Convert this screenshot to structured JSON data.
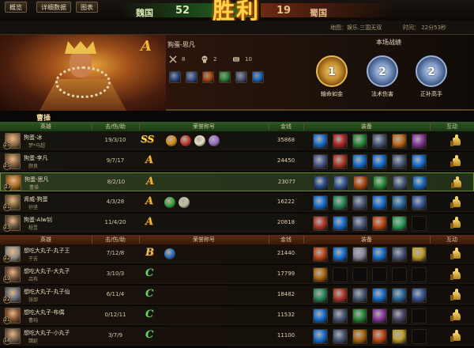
{
  "scoreboard": {
    "team_left": "魏国",
    "score_left": "52",
    "victory_text": "胜利",
    "score_right": "19",
    "team_right": "蜀国"
  },
  "tabs": [
    "概览",
    "详细数据",
    "图表"
  ],
  "match_info": {
    "map": "地图：娱乐.三国无双",
    "time": "时间： 22分53秒"
  },
  "banner": {
    "grade": "A",
    "player": "狗蛋-思凡",
    "kills": "8",
    "deaths": "2",
    "assists": "10",
    "performance_title": "本场战绩",
    "medals": [
      {
        "rank": "1",
        "label": "输命如金",
        "color": "#e7b950"
      },
      {
        "rank": "2",
        "label": "法术伤害",
        "color": "#9ab2d8"
      },
      {
        "rank": "2",
        "label": "正补高手",
        "color": "#9ab2d8"
      }
    ],
    "team_label": "曹操",
    "items": [
      {
        "icon": "skill-icon",
        "color": "#2a4a8a"
      },
      {
        "icon": "sword-icon",
        "color": "#3a5a9a"
      },
      {
        "icon": "flame-icon",
        "color": "#b04a14"
      },
      {
        "icon": "jade-icon",
        "color": "#2a8a3a"
      },
      {
        "icon": "blade-icon",
        "color": "#4a5a7a"
      },
      {
        "icon": "crystal-icon",
        "color": "#1a6ac0"
      }
    ]
  },
  "table_headers": {
    "hero": "英雄",
    "kda": "击/伤/助",
    "honor": "荣誉称号",
    "gold": "金钱",
    "equip": "装备",
    "interact": "互动"
  },
  "team_wei": [
    {
      "player": "狗蛋-冰",
      "hero": "梦*马超",
      "level": "25",
      "kda": "19/3/10",
      "grade": "SS",
      "gold": "35868",
      "avatar": "#8a6a4a",
      "honors": [
        "#d88a1a",
        "#c03a2a",
        "#e8e0c0",
        "#9a6ac8"
      ],
      "equip": [
        "#1a70d0",
        "#b02a2a",
        "#2a8a3a",
        "#4a5a7a",
        "#c06a1a",
        "#8a3aa0"
      ]
    },
    {
      "player": "狗蛋-李凡",
      "hero": "颜良",
      "level": "25",
      "kda": "9/7/17",
      "grade": "A",
      "gold": "24450",
      "avatar": "#7a5a3a",
      "honors": [],
      "equip": [
        "#4a5a8a",
        "#b03a2a",
        "#1a70d0",
        "#1a70d0",
        "#4a5a7a",
        "#1a70d0"
      ]
    },
    {
      "player": "狗蛋-思凡",
      "hero": "曹操",
      "level": "23",
      "kda": "8/2/10",
      "grade": "A",
      "gold": "23077",
      "avatar": "#a0641e",
      "self": true,
      "honors": [],
      "equip": [
        "#2a4a8a",
        "#3a5a9a",
        "#b04a14",
        "#2a8a3a",
        "#4a5a7a",
        "#1a6ac0"
      ]
    },
    {
      "player": "肾威-狗蛋",
      "hero": "孙坚",
      "level": "21",
      "kda": "4/3/28",
      "grade": "A",
      "gold": "16222",
      "avatar": "#6a5a3a",
      "honors": [
        "#3aa03a",
        "#c0c0a0"
      ],
      "equip": [
        "#1a70d0",
        "#2a8a5a",
        "#4a5a7a",
        "#1a70d0",
        "#2a6aa0",
        "#3a5a9a"
      ]
    },
    {
      "player": "狗蛋-Alw钊",
      "hero": "程昱",
      "level": "23",
      "kda": "11/4/20",
      "grade": "A",
      "gold": "20818",
      "avatar": "#5a4a3a",
      "honors": [],
      "equip": [
        "#b03a2a",
        "#1a70d0",
        "#4a5a7a",
        "#c04a1a",
        "#2aa05a",
        ""
      ]
    }
  ],
  "team_shu": [
    {
      "player": "想吃大丸子-丸子王",
      "hero": "于吉",
      "level": "22",
      "kda": "7/12/8",
      "grade": "B",
      "gold": "21440",
      "avatar": "#8a8a8a",
      "honors": [
        "#2a6ab0"
      ],
      "equip": [
        "#c04a1a",
        "#1a70d0",
        "#8a8aa0",
        "#1a70d0",
        "#4a5a7a",
        "#c0a02a"
      ]
    },
    {
      "player": "想吃大丸子-大丸子",
      "hero": "吕布",
      "level": "19",
      "kda": "3/10/3",
      "grade": "C",
      "gold": "17799",
      "avatar": "#6a4a3a",
      "honors": [],
      "equip": [
        "#b06a14",
        "",
        "",
        "",
        "",
        ""
      ]
    },
    {
      "player": "想吃大丸子-丸子仙",
      "hero": "张郃",
      "level": "22",
      "kda": "6/11/4",
      "grade": "C",
      "gold": "18482",
      "avatar": "#5a6a7a",
      "honors": [],
      "equip": [
        "#2a8a5a",
        "#b03a2a",
        "#4a5a7a",
        "#1a70d0",
        "#2a6aa0",
        "#3a5a9a"
      ]
    },
    {
      "player": "想吃大丸子-布偶",
      "hero": "曹纯",
      "level": "21",
      "kda": "0/12/11",
      "grade": "C",
      "gold": "11532",
      "avatar": "#7a4a2a",
      "honors": [],
      "equip": [
        "#1a70d0",
        "#4a5a7a",
        "#2a8a3a",
        "#8a3aa0",
        "#4a4a6a",
        ""
      ]
    },
    {
      "player": "想吃大丸子-小丸子",
      "hero": "魏延",
      "level": "18",
      "kda": "3/7/9",
      "grade": "C",
      "gold": "11100",
      "avatar": "#6a5a4a",
      "honors": [],
      "equip": [
        "#1a70d0",
        "#4a5a7a",
        "#b06a14",
        "#c04a1a",
        "#c0a02a",
        ""
      ]
    }
  ]
}
